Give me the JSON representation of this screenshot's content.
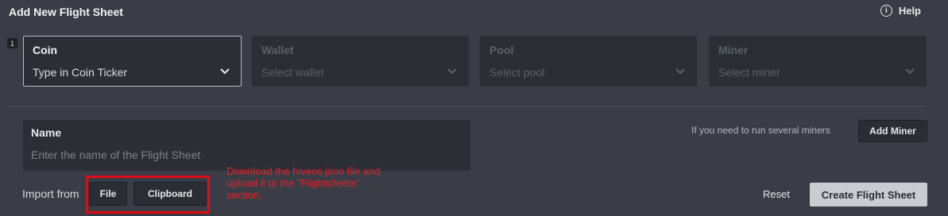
{
  "header": {
    "title": "Add New Flight Sheet",
    "help_label": "Help",
    "help_icon_glyph": "i"
  },
  "step_number": "1",
  "selectors": [
    {
      "label": "Coin",
      "value": "Type in Coin Ticker",
      "enabled": true
    },
    {
      "label": "Wallet",
      "value": "Select wallet",
      "enabled": false
    },
    {
      "label": "Pool",
      "value": "Select pool",
      "enabled": false
    },
    {
      "label": "Miner",
      "value": "Select miner",
      "enabled": false
    }
  ],
  "name_field": {
    "label": "Name",
    "placeholder": "Enter the name of the Flight Sheet"
  },
  "add_miner": {
    "hint": "If you need to run several miners",
    "button_label": "Add Miner"
  },
  "import": {
    "label": "Import from",
    "file_label": "File",
    "clipboard_label": "Clipboard"
  },
  "annotation": {
    "text": "Download the hiveos.json file and upload it to the \"Flightsheets\" section.",
    "color": "#e10a16"
  },
  "actions": {
    "reset_label": "Reset",
    "create_label": "Create Flight Sheet"
  },
  "colors": {
    "background": "#3a3d45",
    "field": "#2b2e35",
    "primary_button": "#c9ccd1"
  }
}
